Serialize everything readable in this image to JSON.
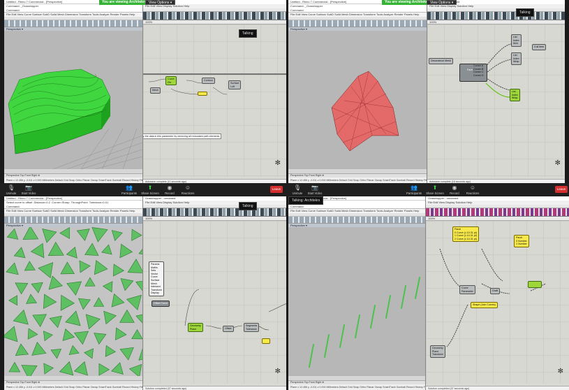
{
  "share_banner": "You are viewing Architekrs' screen",
  "view_options": "View Options ▾",
  "talking": "Talking",
  "talking_named": "Talking: Architekrs",
  "rhino": {
    "title_tl": "Untitled - Rhino 7 Commercial - [Perspective]",
    "menu": "File  Edit  View  Curve  Surface  SubD  Solid  Mesh  Dimension  Transform  Tools  Analyze  Render  Panels  Help",
    "cmd_tl": "Command: _Grasshopper\nCommand:",
    "cmd_bl": "Select curve to offset  Distance=0.2  Corner=Sharp  ThroughPoint  Tolerance=0.01\nCommand:",
    "viewport_label": "Perspective ▾",
    "view_tabs": "Perspective  Top  Front  Right  ⊕",
    "status": "Plane   x 12.456   y -3.011   z 0.000   Millimeters   Default   Grid Snap  Ortho  Planar  Osnap  SmartTrack  Gumball  Record History  Filter"
  },
  "grasshopper": {
    "title": "Grasshopper - unnamed",
    "menu": "File  Edit  View  Display  Solution  Help",
    "zoom": "100%",
    "status_tl": "Autosave complete (11 seconds ago)",
    "status_tr": "Autosave complete (18 seconds ago)",
    "status_bl": "Solution completed (37 seconds ago)",
    "tip_tl": "Simplify the data in this parameter by removing all redundant path elements"
  },
  "nodes": {
    "tl_a": "Curve\nDiv",
    "tl_b": "Contour",
    "tl_c": "Mesh",
    "tl_d": "Surface\nLoft",
    "tr_deco": "Deconstruct Mesh",
    "tr_face": "Face",
    "tr_corner": "Corner A\nCorner B\nCorner C\nCorner D",
    "tr_list1": "List\nIndex\nItem",
    "tr_list2": "List\nIndex\nWrap",
    "tr_list3": "List\nIndex\nWrap",
    "tr_cull": "Cull Item",
    "bl_menu": "Params\nMaths\nSets\nVector\nCurve\nSurface\nMesh\nIntersect\nTransform\nDisplay",
    "bl_pop": "Offset Curve",
    "bl_a": "Geometry\nPlane",
    "bl_b": "Offset",
    "bl_c": "Segments\nTolerance",
    "br_panel1": "Panel\n0 Curve (L:10.31 pt)\n1 Curve (L:10.31 pt)\n2 Curve (L:10.31 pt)",
    "br_panel2": "Panel\n0 Number\n1 Number",
    "br_curve": "Curve\nParameter",
    "br_shape": "Shape (Join Curves)",
    "br_graft": "Graft",
    "br_geom": "Geometry\nPlane\nTransform"
  },
  "zoom_bar": {
    "unmute": "Unmute",
    "start_video": "Start Video",
    "participants": "Participants",
    "share_screen": "Share Screen",
    "record": "Record",
    "reactions": "Reactions",
    "leave": "Leave"
  }
}
